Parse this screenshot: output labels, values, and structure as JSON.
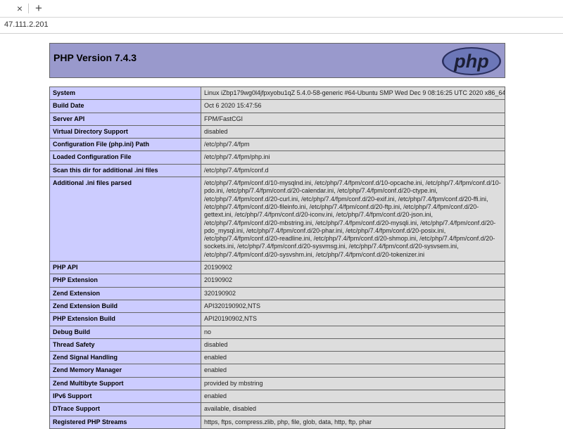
{
  "browser": {
    "tab_close_glyph": "×",
    "new_tab_glyph": "+",
    "url": "47.111.2.201"
  },
  "header": {
    "title": "PHP Version 7.4.3",
    "logo_text": "php"
  },
  "colors": {
    "header_bg": "#9999cc",
    "key_bg": "#ccccff",
    "value_bg": "#dddddd"
  },
  "rows": [
    {
      "key": "System",
      "value": "Linux iZbp179wg0l4jfpxyobu1qZ 5.4.0-58-generic #64-Ubuntu SMP Wed Dec 9 08:16:25 UTC 2020 x86_64"
    },
    {
      "key": "Build Date",
      "value": "Oct 6 2020 15:47:56"
    },
    {
      "key": "Server API",
      "value": "FPM/FastCGI"
    },
    {
      "key": "Virtual Directory Support",
      "value": "disabled"
    },
    {
      "key": "Configuration File (php.ini) Path",
      "value": "/etc/php/7.4/fpm"
    },
    {
      "key": "Loaded Configuration File",
      "value": "/etc/php/7.4/fpm/php.ini"
    },
    {
      "key": "Scan this dir for additional .ini files",
      "value": "/etc/php/7.4/fpm/conf.d"
    },
    {
      "key": "Additional .ini files parsed",
      "value": "/etc/php/7.4/fpm/conf.d/10-mysqlnd.ini, /etc/php/7.4/fpm/conf.d/10-opcache.ini, /etc/php/7.4/fpm/conf.d/10-pdo.ini, /etc/php/7.4/fpm/conf.d/20-calendar.ini, /etc/php/7.4/fpm/conf.d/20-ctype.ini, /etc/php/7.4/fpm/conf.d/20-curl.ini, /etc/php/7.4/fpm/conf.d/20-exif.ini, /etc/php/7.4/fpm/conf.d/20-ffi.ini, /etc/php/7.4/fpm/conf.d/20-fileinfo.ini, /etc/php/7.4/fpm/conf.d/20-ftp.ini, /etc/php/7.4/fpm/conf.d/20-gettext.ini, /etc/php/7.4/fpm/conf.d/20-iconv.ini, /etc/php/7.4/fpm/conf.d/20-json.ini, /etc/php/7.4/fpm/conf.d/20-mbstring.ini, /etc/php/7.4/fpm/conf.d/20-mysqli.ini, /etc/php/7.4/fpm/conf.d/20-pdo_mysql.ini, /etc/php/7.4/fpm/conf.d/20-phar.ini, /etc/php/7.4/fpm/conf.d/20-posix.ini, /etc/php/7.4/fpm/conf.d/20-readline.ini, /etc/php/7.4/fpm/conf.d/20-shmop.ini, /etc/php/7.4/fpm/conf.d/20-sockets.ini, /etc/php/7.4/fpm/conf.d/20-sysvmsg.ini, /etc/php/7.4/fpm/conf.d/20-sysvsem.ini, /etc/php/7.4/fpm/conf.d/20-sysvshm.ini, /etc/php/7.4/fpm/conf.d/20-tokenizer.ini"
    },
    {
      "key": "PHP API",
      "value": "20190902"
    },
    {
      "key": "PHP Extension",
      "value": "20190902"
    },
    {
      "key": "Zend Extension",
      "value": "320190902"
    },
    {
      "key": "Zend Extension Build",
      "value": "API320190902,NTS"
    },
    {
      "key": "PHP Extension Build",
      "value": "API20190902,NTS"
    },
    {
      "key": "Debug Build",
      "value": "no"
    },
    {
      "key": "Thread Safety",
      "value": "disabled"
    },
    {
      "key": "Zend Signal Handling",
      "value": "enabled"
    },
    {
      "key": "Zend Memory Manager",
      "value": "enabled"
    },
    {
      "key": "Zend Multibyte Support",
      "value": "provided by mbstring"
    },
    {
      "key": "IPv6 Support",
      "value": "enabled"
    },
    {
      "key": "DTrace Support",
      "value": "available, disabled"
    },
    {
      "key": "Registered PHP Streams",
      "value": "https, ftps, compress.zlib, php, file, glob, data, http, ftp, phar"
    }
  ]
}
